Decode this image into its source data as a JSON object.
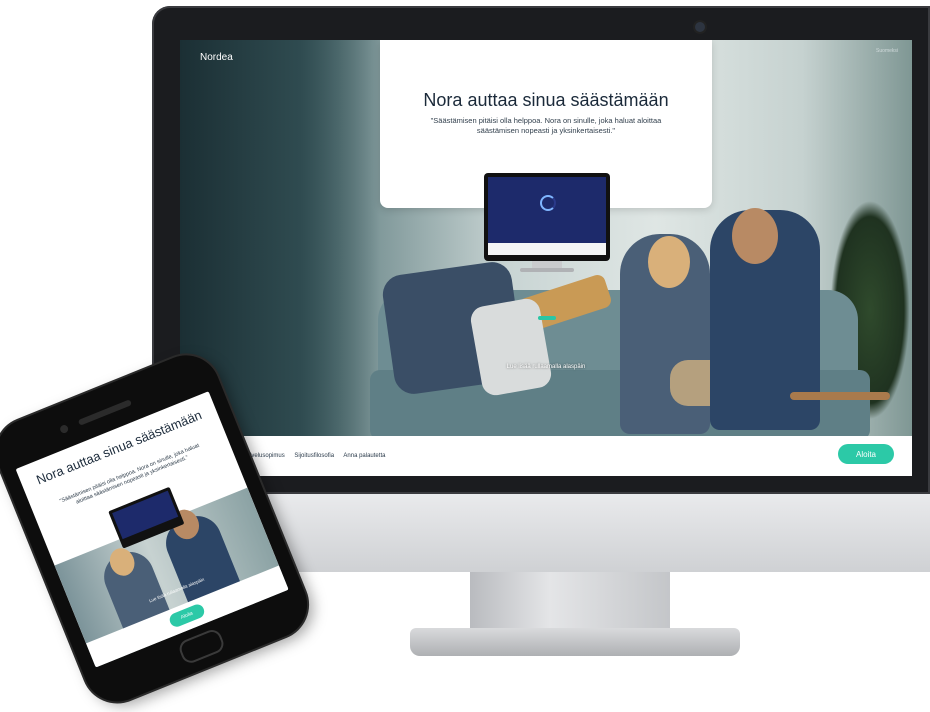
{
  "desktop": {
    "brand": "Nordea",
    "top_right_link": "Suomeksi",
    "hero": {
      "title": "Nora auttaa sinua säästämään",
      "quote": "\"Säästämisen pitäisi olla helppoa. Nora on sinulle, joka haluat aloittaa säästämisen nopeasti ja yksinkertaisesti.\""
    },
    "scroll_hint": "Lue lisää rullaamalla alaspäin",
    "footer_links": [
      "Sijoituspalvelusopimus",
      "Sijoitusfilosofia",
      "Anna palautetta"
    ],
    "cta": "Aloita"
  },
  "phone": {
    "title": "Nora auttaa sinua säästämään",
    "quote": "\"Säästämisen pitäisi olla helppoa. Nora on sinulle, joka haluat aloittaa säästämisen nopeasti ja yksinkertaisesti.\"",
    "scroll_hint": "Lue lisää rullaamalla alaspäin",
    "cta": "Aloita"
  },
  "colors": {
    "accent": "#2cc9a7",
    "title_text": "#1b2a3a",
    "mini_screen": "#1d2a6b"
  }
}
